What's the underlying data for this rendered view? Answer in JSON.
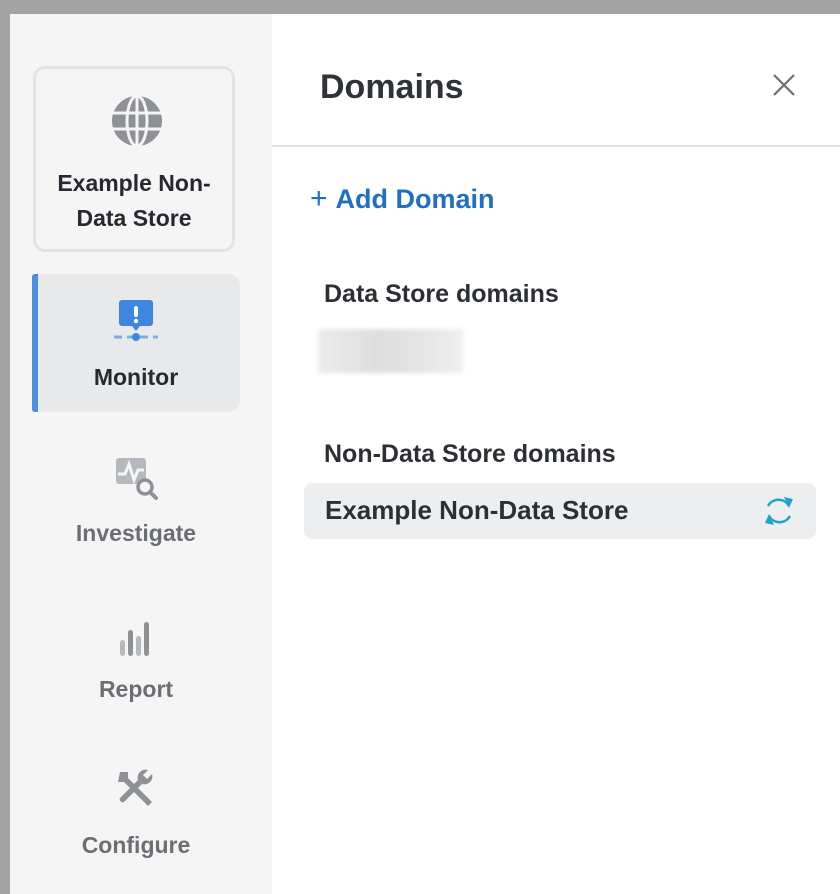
{
  "sidebar": {
    "context": {
      "label": "Example Non-Data Store",
      "icon": "globe-icon"
    },
    "items": [
      {
        "id": "monitor",
        "label": "Monitor",
        "icon": "monitor-alert-icon",
        "active": true
      },
      {
        "id": "investigate",
        "label": "Investigate",
        "icon": "investigate-icon",
        "active": false
      },
      {
        "id": "report",
        "label": "Report",
        "icon": "bar-chart-icon",
        "active": false
      },
      {
        "id": "configure",
        "label": "Configure",
        "icon": "tools-icon",
        "active": false
      }
    ]
  },
  "panel": {
    "title": "Domains",
    "close_icon": "close-icon",
    "add_label": "Add Domain",
    "sections": [
      {
        "heading": "Data Store domains",
        "items": []
      },
      {
        "heading": "Non-Data Store domains",
        "items": [
          {
            "label": "Example Non-Data Store",
            "icon": "sync-icon"
          }
        ]
      }
    ]
  },
  "colors": {
    "accent": "#4a90e2",
    "link": "#1f6fc5",
    "sync": "#1fa5c8",
    "sidebar_bg": "#f5f5f6"
  }
}
